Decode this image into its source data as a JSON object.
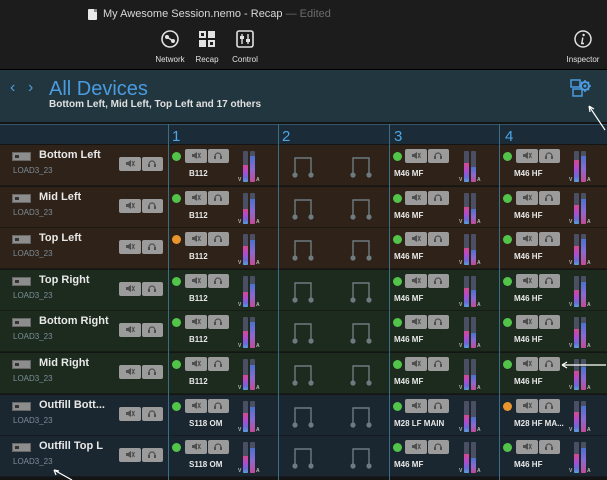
{
  "window": {
    "title": "My Awesome Session.nemo - Recap",
    "edited": "— Edited"
  },
  "toolbar": {
    "network": "Network",
    "recap": "Recap",
    "control": "Control",
    "inspector": "Inspector"
  },
  "header": {
    "title": "All Devices",
    "subtitle": "Bottom Left, Mid Left, Top Left and 17 others"
  },
  "channels": [
    "1",
    "2",
    "3",
    "4"
  ],
  "meter_letters": {
    "v": "V",
    "a": "A"
  },
  "colors": {
    "accent": "#4a9be0",
    "row_orange": "#2f2218",
    "row_green": "#1c2b1e",
    "row_blue": "#1a2730",
    "led_green": "#52c44a",
    "led_orange": "#e8952e"
  },
  "rows": [
    {
      "name": "Bottom Left",
      "model": "LOAD3_23",
      "group": "orange",
      "ch1": "B112",
      "ch3": "M46 MF",
      "ch4": "M46 HF",
      "led1": "green",
      "led4": "green",
      "lvl": [
        0.55,
        0.85,
        0.6,
        0.5,
        0.7,
        0.85
      ]
    },
    {
      "name": "Mid Left",
      "model": "LOAD3_23",
      "group": "orange",
      "ch1": "B112",
      "ch3": "M46 MF",
      "ch4": "M46 HF",
      "led1": "green",
      "led4": "green",
      "lvl": [
        0.5,
        0.8,
        0.55,
        0.5,
        0.6,
        0.8
      ]
    },
    {
      "name": "Top Left",
      "model": "LOAD3_23",
      "group": "orange",
      "ch1": "B112",
      "ch3": "M46 MF",
      "ch4": "M46 HF",
      "led1": "orange",
      "led4": "green",
      "lvl": [
        0.6,
        0.8,
        0.55,
        0.5,
        0.6,
        0.85
      ]
    },
    {
      "name": "Top Right",
      "model": "LOAD3_23",
      "group": "green",
      "ch1": "B112",
      "ch3": "M46 MF",
      "ch4": "M46 HF",
      "led1": "green",
      "led4": "green",
      "lvl": [
        0.5,
        0.75,
        0.6,
        0.55,
        0.55,
        0.8
      ]
    },
    {
      "name": "Bottom Right",
      "model": "LOAD3_23",
      "group": "green",
      "ch1": "B112",
      "ch3": "M46 MF",
      "ch4": "M46 HF",
      "led1": "green",
      "led4": "green",
      "lvl": [
        0.55,
        0.85,
        0.55,
        0.5,
        0.6,
        0.8
      ]
    },
    {
      "name": "Mid Right",
      "model": "LOAD3_23",
      "group": "green",
      "ch1": "B112",
      "ch3": "M46 MF",
      "ch4": "M46 HF",
      "led1": "green",
      "led4": "green",
      "lvl": [
        0.5,
        0.8,
        0.5,
        0.5,
        0.6,
        0.75
      ]
    },
    {
      "name": "Outfill Bott...",
      "model": "LOAD3_23",
      "group": "blue",
      "ch1": "S118 OM",
      "ch3": "M28 LF MAIN",
      "ch4": "M28 HF MA...",
      "led1": "green",
      "led4": "orange",
      "lvl": [
        0.6,
        0.8,
        0.55,
        0.5,
        0.65,
        0.85
      ]
    },
    {
      "name": "Outfill Top L",
      "model": "LOAD3_23",
      "group": "blue",
      "ch1": "S118 OM",
      "ch3": "M46 MF",
      "ch4": "M46 HF",
      "led1": "green",
      "led4": "green",
      "lvl": [
        0.55,
        0.8,
        0.6,
        0.5,
        0.6,
        0.8
      ]
    }
  ]
}
